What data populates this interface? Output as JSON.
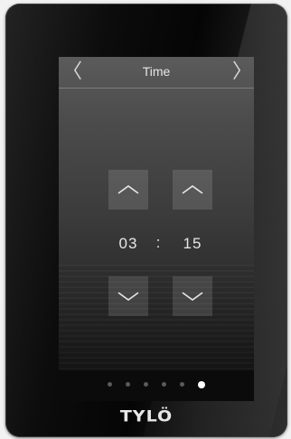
{
  "screen": {
    "title": "Time",
    "nav": {
      "prev_icon": "chevron-left-icon",
      "next_icon": "chevron-right-icon",
      "prev_glyph": "〈",
      "next_glyph": "〉"
    }
  },
  "time": {
    "hours": "03",
    "separator": ":",
    "minutes": "15"
  },
  "controls": {
    "hours_up": "chevron-up-icon",
    "minutes_up": "chevron-up-icon",
    "hours_down": "chevron-down-icon",
    "minutes_down": "chevron-down-icon"
  },
  "pagination": {
    "total": 6,
    "active_index": 5
  },
  "brand": {
    "logo_text": "TYLÖ"
  },
  "colors": {
    "accent_active_dot": "#ffffff",
    "inactive_dot": "#5a5a5a",
    "text": "#e6e6e6"
  }
}
